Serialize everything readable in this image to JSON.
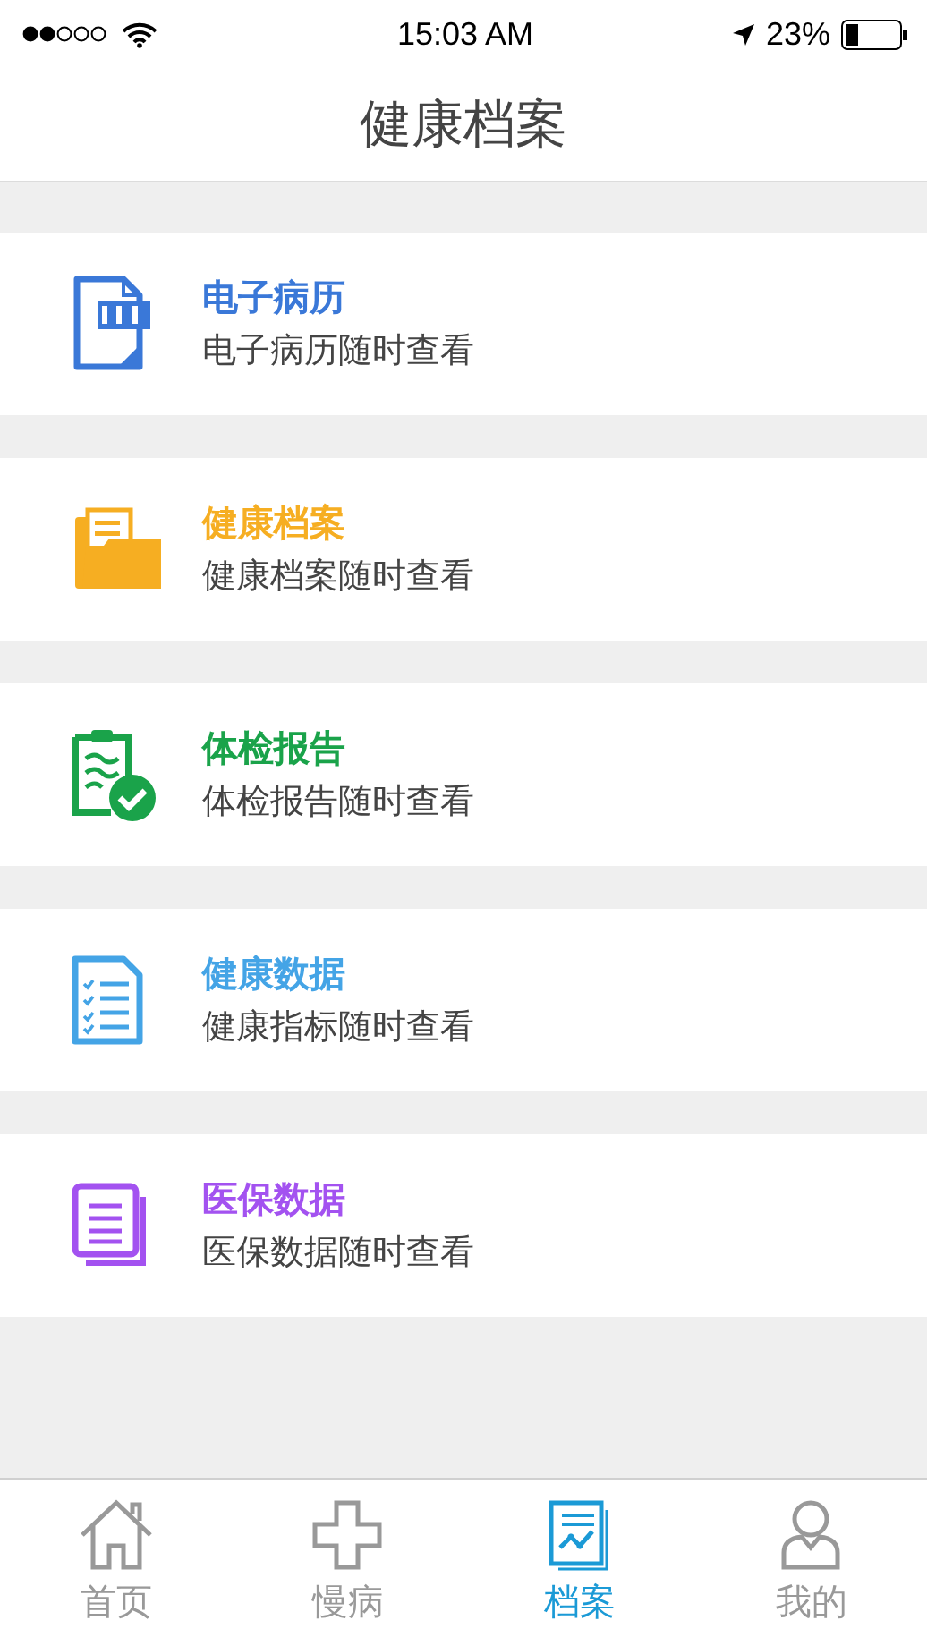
{
  "status_bar": {
    "time": "15:03 AM",
    "battery_text": "23%"
  },
  "nav_bar": {
    "title": "健康档案"
  },
  "records": [
    {
      "kind": "pdf",
      "title": "电子病历",
      "subtitle": "电子病历随时查看",
      "color": "#3a78d8"
    },
    {
      "kind": "folder",
      "title": "健康档案",
      "subtitle": "健康档案随时查看",
      "color": "#f6ae22"
    },
    {
      "kind": "report",
      "title": "体检报告",
      "subtitle": "体检报告随时查看",
      "color": "#1aa34a"
    },
    {
      "kind": "checklist",
      "title": "健康数据",
      "subtitle": "健康指标随时查看",
      "color": "#44a4e6"
    },
    {
      "kind": "documents",
      "title": "医保数据",
      "subtitle": "医保数据随时查看",
      "color": "#a352f0"
    }
  ],
  "tab_bar": [
    {
      "kind": "home",
      "label": "首页",
      "selected": false
    },
    {
      "kind": "cross",
      "label": "慢病",
      "selected": false
    },
    {
      "kind": "archive",
      "label": "档案",
      "selected": true
    },
    {
      "kind": "person",
      "label": "我的",
      "selected": false
    }
  ]
}
